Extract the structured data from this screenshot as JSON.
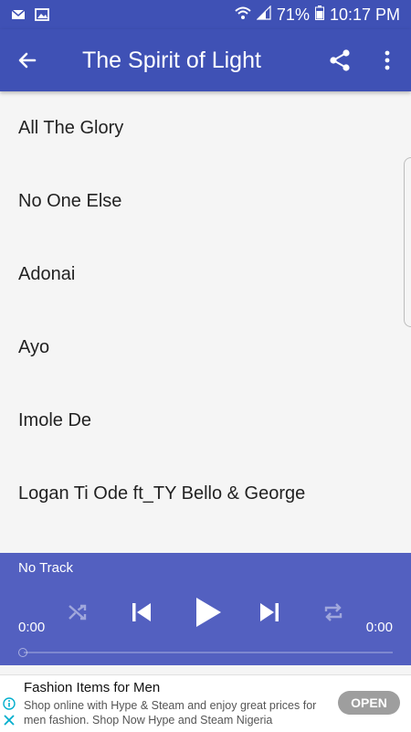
{
  "status_bar": {
    "battery": "71%",
    "time": "10:17 PM",
    "icons": [
      "email-icon",
      "image-icon",
      "wifi-icon",
      "signal-icon",
      "battery-icon"
    ]
  },
  "app_bar": {
    "title": "The Spirit of Light",
    "icons": [
      "back-arrow-icon",
      "share-icon",
      "more-vert-icon"
    ]
  },
  "songs": [
    {
      "title": "All The Glory"
    },
    {
      "title": "No One Else"
    },
    {
      "title": "Adonai"
    },
    {
      "title": "Ayo"
    },
    {
      "title": "Imole De"
    },
    {
      "title": "Logan Ti Ode ft_TY Bello & George"
    }
  ],
  "player": {
    "track": "No Track",
    "current_time": "0:00",
    "total_time": "0:00",
    "progress": 0,
    "icons": [
      "shuffle-icon",
      "previous-icon",
      "play-icon",
      "next-icon",
      "repeat-icon"
    ]
  },
  "ad": {
    "title": "Fashion Items for Men",
    "text": "Shop online with Hype & Steam and enjoy great prices for men fashion. Shop Now Hype and Steam Nigeria",
    "button": "OPEN"
  },
  "colors": {
    "primary": "#3f51b5",
    "player_bg": "#5360c0",
    "ad_button": "#9e9e9e"
  }
}
